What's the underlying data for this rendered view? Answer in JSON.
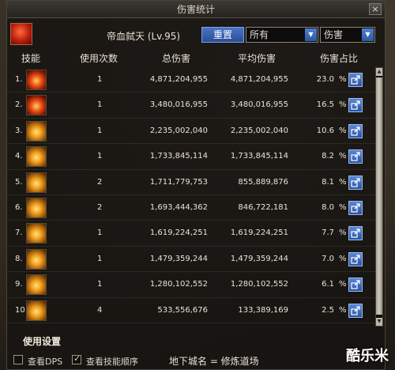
{
  "window": {
    "title": "伤害统计",
    "close_label": "×"
  },
  "toolbar": {
    "player_name": "帝血弑天 (Lv.95)",
    "reset_label": "重置",
    "filter_select": "所有",
    "type_select": "伤害"
  },
  "table": {
    "headers": {
      "skill": "技能",
      "count": "使用次数",
      "total": "总伤害",
      "avg": "平均伤害",
      "pct": "伤害占比"
    },
    "rows": [
      {
        "index": "1.",
        "count": "1",
        "total": "4,871,204,955",
        "avg": "4,871,204,955",
        "pct": "23.0",
        "pct_unit": "%",
        "icon": "fire-slash-skill-icon"
      },
      {
        "index": "2.",
        "count": "1",
        "total": "3,480,016,955",
        "avg": "3,480,016,955",
        "pct": "16.5",
        "pct_unit": "%",
        "icon": "fire-burst-skill-icon"
      },
      {
        "index": "3.",
        "count": "1",
        "total": "2,235,002,040",
        "avg": "2,235,002,040",
        "pct": "10.6",
        "pct_unit": "%",
        "icon": "explosion-skill-icon"
      },
      {
        "index": "4.",
        "count": "1",
        "total": "1,733,845,114",
        "avg": "1,733,845,114",
        "pct": "8.2",
        "pct_unit": "%",
        "icon": "starburst-skill-icon"
      },
      {
        "index": "5.",
        "count": "2",
        "total": "1,711,779,753",
        "avg": "855,889,876",
        "pct": "8.1",
        "pct_unit": "%",
        "icon": "lightning-skill-icon"
      },
      {
        "index": "6.",
        "count": "2",
        "total": "1,693,444,362",
        "avg": "846,722,181",
        "pct": "8.0",
        "pct_unit": "%",
        "icon": "nova-skill-icon"
      },
      {
        "index": "7.",
        "count": "1",
        "total": "1,619,224,251",
        "avg": "1,619,224,251",
        "pct": "7.7",
        "pct_unit": "%",
        "icon": "strike-skill-icon"
      },
      {
        "index": "8.",
        "count": "1",
        "total": "1,479,359,244",
        "avg": "1,479,359,244",
        "pct": "7.0",
        "pct_unit": "%",
        "icon": "pillar-skill-icon"
      },
      {
        "index": "9.",
        "count": "1",
        "total": "1,280,102,552",
        "avg": "1,280,102,552",
        "pct": "6.1",
        "pct_unit": "%",
        "icon": "flame-wave-skill-icon"
      },
      {
        "index": "10.",
        "count": "4",
        "total": "533,556,676",
        "avg": "133,389,169",
        "pct": "2.5",
        "pct_unit": "%",
        "icon": "dash-skill-icon"
      }
    ]
  },
  "footer": {
    "settings_label": "使用设置",
    "view_dps_label": "查看DPS",
    "view_dps_checked": false,
    "skill_order_label": "查看技能顺序",
    "skill_order_checked": true,
    "dungeon_text": "地下城名 = 修炼道场"
  },
  "watermark": "酷乐米"
}
